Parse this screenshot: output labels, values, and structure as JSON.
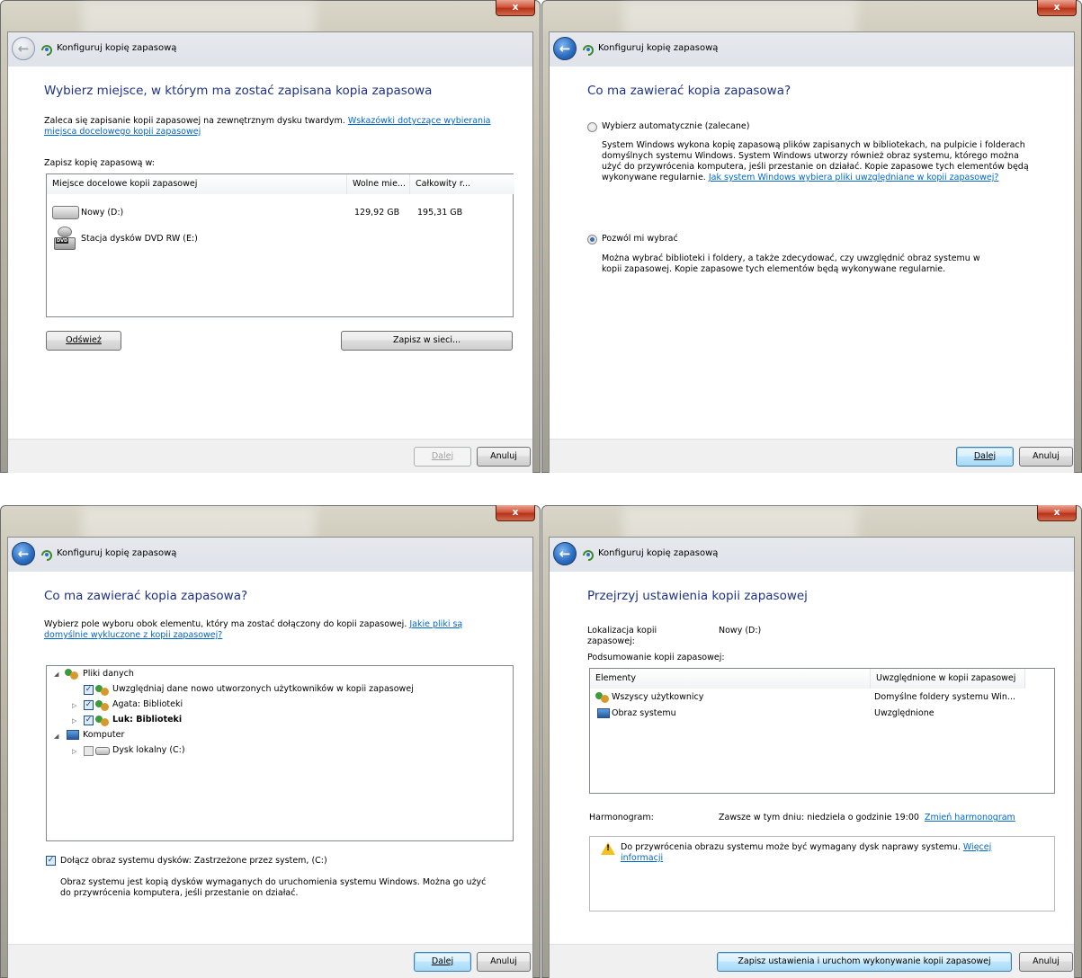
{
  "window": {
    "title": "Konfiguruj kopię zapasową",
    "close_glyph": "x"
  },
  "p1": {
    "heading": "Wybierz miejsce, w którym ma zostać zapisana kopia zapasowa",
    "intro": "Zaleca się zapisanie kopii zapasowej na zewnętrznym dysku twardym.",
    "intro_link_a": "Wskazówki dotyczące wybierania",
    "intro_link_b": "miejsca docelowego kopii zapasowej",
    "save_label": "Zapisz kopię zapasową w:",
    "columns": [
      "Miejsce docelowe kopii zapasowej",
      "Wolne mie...",
      "Całkowity r..."
    ],
    "rows": [
      {
        "name": "Nowy (D:)",
        "free": "129,92 GB",
        "total": "195,31 GB",
        "icon": "hard-drive-icon"
      },
      {
        "name": "Stacja dysków DVD RW (E:)",
        "free": "",
        "total": "",
        "icon": "dvd-drive-icon"
      }
    ],
    "refresh_btn": "Odśwież",
    "network_btn": "Zapisz w sieci...",
    "next_btn": "Dalej",
    "cancel_btn": "Anuluj"
  },
  "p2": {
    "heading": "Co ma zawierać kopia zapasowa?",
    "auto_label": "Wybierz automatycznie (zalecane)",
    "auto_desc_1": "System Windows wykona kopię zapasową plików zapisanych w bibliotekach, na pulpicie i folderach",
    "auto_desc_2": "domyślnych systemu Windows. System Windows utworzy również obraz systemu, którego można",
    "auto_desc_3": "użyć do przywrócenia komputera, jeśli przestanie on działać. Kopie zapasowe tych elementów będą",
    "auto_desc_4": "wykonywane regularnie.",
    "auto_link": "Jak system Windows wybiera pliki uwzględniane w kopii zapasowej?",
    "manual_label": "Pozwól mi wybrać",
    "manual_desc_1": "Można wybrać biblioteki i foldery, a także zdecydować, czy uwzględnić obraz systemu w",
    "manual_desc_2": "kopii zapasowej. Kopie zapasowe tych elementów będą wykonywane regularnie.",
    "next_btn": "Dalej",
    "cancel_btn": "Anuluj"
  },
  "p3": {
    "heading": "Co ma zawierać kopia zapasowa?",
    "intro": "Wybierz pole wyboru obok elementu, który ma zostać dołączony do kopii zapasowej.",
    "intro_link_a": "Jakie pliki są",
    "intro_link_b": "domyślnie wykluczone z kopii zapasowej?",
    "tree": {
      "data_files": "Pliki danych",
      "new_users": "Uwzględniaj dane nowo utworzonych użytkowników w kopii zapasowej",
      "agata": "Agata: Biblioteki",
      "luk": "Luk: Biblioteki",
      "computer": "Komputer",
      "local_disk": "Dysk lokalny (C:)"
    },
    "system_image_label": "Dołącz obraz systemu dysków: Zastrzeżone przez system, (C:)",
    "system_image_desc_1": "Obraz systemu jest kopią dysków wymaganych do uruchomienia systemu Windows. Można go użyć",
    "system_image_desc_2": "do przywrócenia komputera, jeśli przestanie on działać.",
    "next_btn": "Dalej",
    "cancel_btn": "Anuluj"
  },
  "p4": {
    "heading": "Przejrzyj ustawienia kopii zapasowej",
    "location_label_1": "Lokalizacja kopii",
    "location_label_2": "zapasowej:",
    "location_value": "Nowy (D:)",
    "summary_label": "Podsumowanie kopii zapasowej:",
    "columns": [
      "Elementy",
      "Uwzględnione w kopii zapasowej"
    ],
    "rows": [
      {
        "item": "Wszyscy użytkownicy",
        "value": "Domyślne foldery systemu Win...",
        "icon": "users-icon"
      },
      {
        "item": "Obraz systemu",
        "value": "Uwzględnione",
        "icon": "computer-icon"
      }
    ],
    "schedule_label": "Harmonogram:",
    "schedule_value": "Zawsze w tym dniu: niedziela o godzinie 19:00",
    "schedule_link": "Zmień harmonogram",
    "warning_text": "Do przywrócenia obrazu systemu może być wymagany dysk naprawy systemu.",
    "warning_link_a": "Więcej",
    "warning_link_b": "informacji",
    "save_run_btn": "Zapisz ustawienia i uruchom wykonywanie kopii zapasowej",
    "cancel_btn": "Anuluj"
  }
}
